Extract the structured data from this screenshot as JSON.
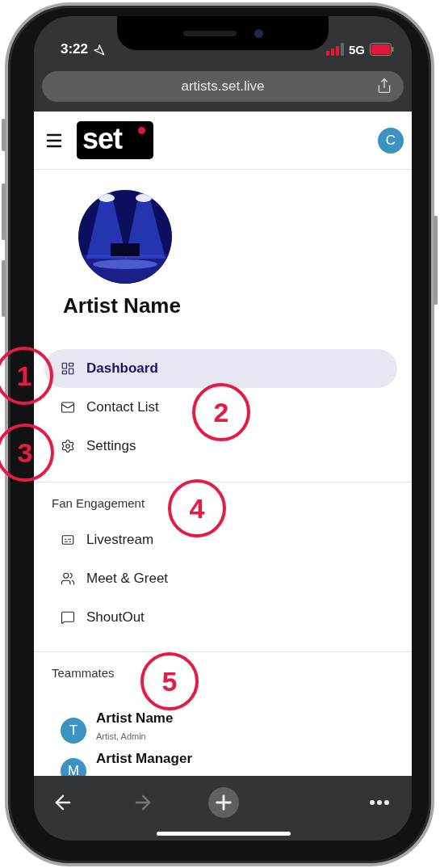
{
  "status_bar": {
    "time": "3:22",
    "network": "5G"
  },
  "browser": {
    "url": "artists.set.live"
  },
  "header": {
    "logo": "set",
    "avatar": "C"
  },
  "profile": {
    "name": "Artist Name"
  },
  "nav": [
    {
      "label": "Dashboard",
      "selected": true
    },
    {
      "label": "Contact List",
      "selected": false
    },
    {
      "label": "Settings",
      "selected": false
    }
  ],
  "fan_engagement": {
    "title": "Fan Engagement",
    "items": [
      {
        "label": "Livestream",
        "selected": false
      },
      {
        "label": "Meet & Greet",
        "selected": false
      },
      {
        "label": "ShoutOut",
        "selected": false
      }
    ]
  },
  "teammates": {
    "title": "Teammates",
    "members": [
      {
        "initial": "T",
        "name": "Artist Name",
        "roles": "Artist, Admin"
      },
      {
        "initial": "M",
        "name": "Artist Manager"
      }
    ]
  },
  "toolbar": [
    {
      "kind": "back",
      "disabled": false
    },
    {
      "kind": "forward",
      "disabled": true
    },
    {
      "kind": "new-tab",
      "disabled": false
    },
    {
      "kind": "more",
      "disabled": false
    }
  ],
  "annotations": [
    {
      "label": "1"
    },
    {
      "label": "2"
    },
    {
      "label": "3"
    },
    {
      "label": "4"
    },
    {
      "label": "5"
    }
  ]
}
